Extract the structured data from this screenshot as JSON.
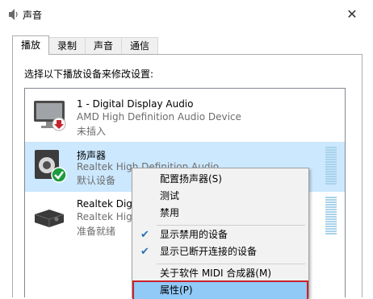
{
  "window": {
    "title": "声音",
    "close_glyph": "✕"
  },
  "tabs": [
    {
      "label": "播放",
      "active": true
    },
    {
      "label": "录制",
      "active": false
    },
    {
      "label": "声音",
      "active": false
    },
    {
      "label": "通信",
      "active": false
    }
  ],
  "instruction": "选择以下播放设备来修改设置:",
  "devices": [
    {
      "name": "1 - Digital Display Audio",
      "driver": "AMD High Definition Audio Device",
      "status": "未插入",
      "icon": "monitor-icon",
      "badge": "unplugged-badge-icon"
    },
    {
      "name": "扬声器",
      "driver": "Realtek High Definition Audio",
      "status": "默认设备",
      "icon": "speaker-icon",
      "badge": "default-check-badge-icon"
    },
    {
      "name": "Realtek Digi",
      "driver": "Realtek High",
      "status": "准备就绪",
      "icon": "digital-output-icon",
      "badge": ""
    }
  ],
  "context_menu": {
    "items": [
      {
        "label": "配置扬声器(S)",
        "checked": false
      },
      {
        "label": "测试",
        "checked": false
      },
      {
        "label": "禁用",
        "checked": false
      },
      {
        "label": "显示禁用的设备",
        "checked": true
      },
      {
        "label": "显示已断开连接的设备",
        "checked": true
      },
      {
        "label": "关于软件 MIDI 合成器(M)",
        "checked": false
      },
      {
        "label": "属性(P)",
        "checked": false,
        "highlighted": true
      }
    ],
    "check_glyph": "✔"
  },
  "colors": {
    "selection": "#cce8ff",
    "menu_highlight": "#91c9f7",
    "callout_border": "#c8232c",
    "check": "#2a6fb5"
  }
}
